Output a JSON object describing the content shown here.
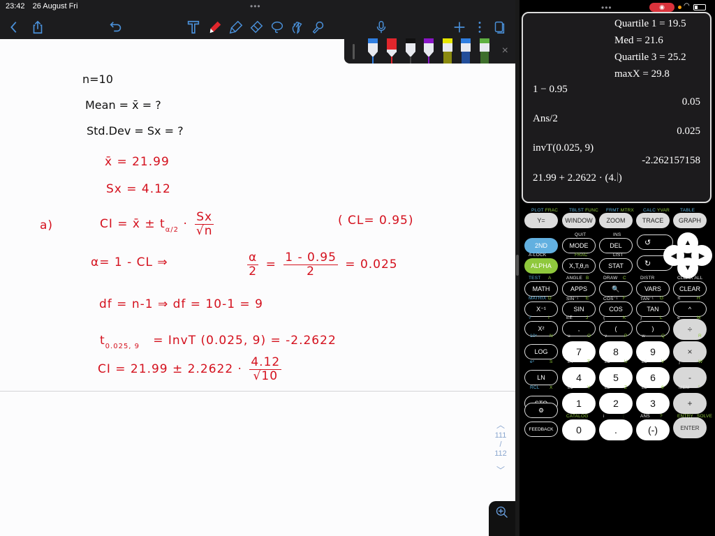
{
  "status_bar": {
    "time": "23:42",
    "date": "26 August Fri"
  },
  "toolbar": {
    "icons": [
      "back-icon",
      "share-icon",
      "undo-icon",
      "text-tool-icon",
      "pen-tool-icon",
      "highlighter-icon",
      "eraser-icon",
      "lasso-icon",
      "hand-tool-icon",
      "laser-pointer-icon",
      "microphone-icon",
      "add-page-icon",
      "more-icon",
      "pages-icon"
    ]
  },
  "pen_tray": {
    "pens": [
      {
        "color": "#2f7ee0",
        "type": "pen"
      },
      {
        "color": "#e0262c",
        "type": "pen",
        "selected": true
      },
      {
        "color": "#111111",
        "type": "pen"
      },
      {
        "color": "#8a16c8",
        "type": "pen"
      },
      {
        "color": "#e6e600",
        "type": "highlighter"
      },
      {
        "color": "#2f7ee0",
        "type": "highlighter"
      },
      {
        "color": "#5fb040",
        "type": "highlighter"
      }
    ],
    "close_symbol": "×"
  },
  "note": {
    "given": {
      "n": "n=10",
      "mean": "Mean = x̄ = ?",
      "std": "Std.Dev = Sx = ?"
    },
    "results": {
      "xbar": "x̄ = 21.99",
      "sx": "Sx = 4.12"
    },
    "part_a": {
      "label": "a)",
      "ci_formula_left": "CI = x̄ ± t",
      "ci_formula_sub": "α/2",
      "ci_formula_frac_num": "Sx",
      "ci_formula_frac_den": "√n",
      "cl": "( CL= 0.95)",
      "alpha_line_left": "α= 1 - CL   ⇒",
      "alpha_frac_num": "α",
      "alpha_frac_den": "2",
      "alpha_eq": "=",
      "alpha_frac2_num": "1 - 0.95",
      "alpha_frac2_den": "2",
      "alpha_result": "= 0.025",
      "df_line": "df = n-1   ⇒  df = 10-1 = 9",
      "t_left": "t",
      "t_sub": "0.025, 9",
      "t_right": "= InvT (0.025, 9) = -2.2622",
      "ci_calc_left": "CI = 21.99 ± 2.2622 ·",
      "ci_calc_num": "4.12",
      "ci_calc_den": "√10"
    }
  },
  "pager": {
    "current": "111",
    "separator": "/",
    "total": "112"
  },
  "calculator": {
    "screen": {
      "stat_lines": [
        "Quartile 1 = 19.5",
        "Med = 21.6",
        "Quartile 3 = 25.2",
        "maxX = 29.8"
      ],
      "history": [
        {
          "input": "1 − 0.95",
          "output": "0.05"
        },
        {
          "input": "Ans/2",
          "output": "0.025"
        },
        {
          "input": "invT(0.025, 9)",
          "output": "-2.262157158"
        }
      ],
      "current_entry_before": "21.99 + 2.2622 · (4.",
      "current_entry_after": ")"
    },
    "keys": {
      "row1": [
        {
          "top": "PLOT",
          "top2": "FRAC",
          "label": "Y="
        },
        {
          "top": "TBLST",
          "top2": "FUNC",
          "label": "WINDOW"
        },
        {
          "top": "FRMT",
          "top2": "MTRX",
          "label": "ZOOM"
        },
        {
          "top": "CALC",
          "top2": "YVAR",
          "label": "TRACE"
        },
        {
          "top": "TABLE",
          "top2": "",
          "label": "GRAPH"
        }
      ],
      "second": "2ND",
      "alpha": "ALPHA",
      "alpha_top": "A-LOCK",
      "mode": "MODE",
      "mode_top": "QUIT",
      "del": "DEL",
      "del_top": "INS",
      "xt": "X,T,θ,n",
      "xt_top": "FRAC",
      "stat": "STAT",
      "stat_top": "LIST",
      "row_math": [
        {
          "top": "TEST",
          "top2": "A",
          "label": "MATH"
        },
        {
          "top": "ANGLE",
          "top2": "B",
          "label": "APPS"
        },
        {
          "top": "DRAW",
          "top2": "C",
          "label": "🔍"
        },
        {
          "top": "DISTR",
          "top2": "",
          "label": "VARS"
        },
        {
          "top": "CLEAR ALL",
          "top2": "",
          "label": "CLEAR"
        }
      ],
      "row_trig": [
        {
          "top": "MATRIX",
          "top2": "D",
          "label": "X⁻¹"
        },
        {
          "top": "SIN⁻¹",
          "top2": "E",
          "label": "SIN"
        },
        {
          "top": "COS⁻¹",
          "top2": "F",
          "label": "COS"
        },
        {
          "top": "TAN⁻¹",
          "top2": "G",
          "label": "TAN"
        },
        {
          "top": "π",
          "top2": "H",
          "label": "^"
        }
      ],
      "row_sq": [
        {
          "top": "√",
          "top2": "I",
          "label": "X²"
        },
        {
          "top": "EE",
          "top2": "J",
          "label": ","
        },
        {
          "top": "{",
          "top2": "K",
          "label": "("
        },
        {
          "top": "}",
          "top2": "L",
          "label": ")"
        },
        {
          "top": "e",
          "top2": "M",
          "label": "÷"
        }
      ],
      "row7": [
        {
          "top": "10ˣ",
          "top2": "N",
          "label": "LOG"
        },
        {
          "top": "u",
          "top2": "O",
          "label": "7"
        },
        {
          "top": "v",
          "top2": "P",
          "label": "8"
        },
        {
          "top": "w",
          "top2": "Q",
          "label": "9"
        },
        {
          "top": "[",
          "top2": "R",
          "label": "×"
        }
      ],
      "row4": [
        {
          "top": "eˣ",
          "top2": "S",
          "label": "LN"
        },
        {
          "top": "L4",
          "top2": "T",
          "label": "4"
        },
        {
          "top": "L5",
          "top2": "U",
          "label": "5"
        },
        {
          "top": "L6",
          "top2": "V",
          "label": "6"
        },
        {
          "top": "]",
          "top2": "W",
          "label": "-"
        }
      ],
      "row1n": [
        {
          "top": "RCL",
          "top2": "X",
          "label": "STO"
        },
        {
          "top": "L1",
          "top2": "Y",
          "label": "1"
        },
        {
          "top": "L2",
          "top2": "Z",
          "label": "2"
        },
        {
          "top": "L3",
          "top2": "θ",
          "label": "3"
        },
        {
          "top": "MEM",
          "top2": "\"",
          "label": "+"
        }
      ],
      "row0": [
        {
          "top": "",
          "top2": "",
          "label": "⚙"
        },
        {
          "top": "CATALOG",
          "top2": "",
          "label": "0"
        },
        {
          "top": "i",
          "top2": ":",
          "label": "."
        },
        {
          "top": "ANS",
          "top2": "?",
          "label": "(-)"
        },
        {
          "top": "ENTRY",
          "top2": "SOLVE",
          "label": "ENTER"
        }
      ],
      "feedback": "FEEDBACK"
    }
  }
}
